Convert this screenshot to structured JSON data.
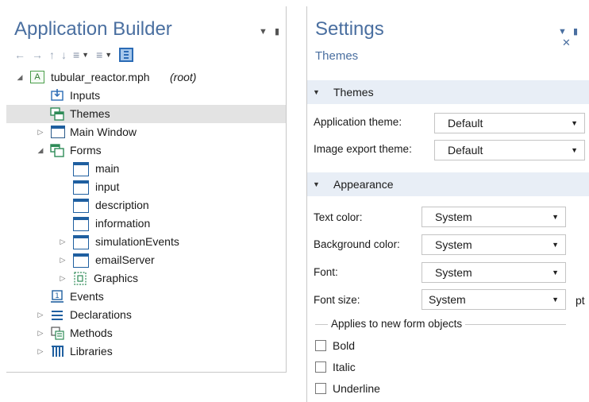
{
  "left": {
    "title": "Application Builder",
    "tree": {
      "root": {
        "label": "tubular_reactor.mph",
        "suffix": "(root)",
        "icon_letter": "A"
      },
      "items": [
        {
          "label": "Inputs"
        },
        {
          "label": "Themes"
        },
        {
          "label": "Main Window"
        },
        {
          "label": "Forms"
        },
        {
          "label": "main"
        },
        {
          "label": "input"
        },
        {
          "label": "description"
        },
        {
          "label": "information"
        },
        {
          "label": "simulationEvents"
        },
        {
          "label": "emailServer"
        },
        {
          "label": "Graphics"
        },
        {
          "label": "Events"
        },
        {
          "label": "Declarations"
        },
        {
          "label": "Methods"
        },
        {
          "label": "Libraries"
        }
      ]
    }
  },
  "right": {
    "title": "Settings",
    "subtitle": "Themes",
    "themes_section": {
      "header": "Themes",
      "application_theme": {
        "label": "Application theme:",
        "value": "Default"
      },
      "image_export_theme": {
        "label": "Image export theme:",
        "value": "Default"
      }
    },
    "appearance_section": {
      "header": "Appearance",
      "text_color": {
        "label": "Text color:",
        "value": "System"
      },
      "background_color": {
        "label": "Background color:",
        "value": "System"
      },
      "font": {
        "label": "Font:",
        "value": "System"
      },
      "font_size": {
        "label": "Font size:",
        "value": "System",
        "unit": "pt"
      },
      "group_label": "Applies to new form objects",
      "checkboxes": [
        {
          "label": "Bold",
          "checked": false
        },
        {
          "label": "Italic",
          "checked": false
        },
        {
          "label": "Underline",
          "checked": false
        }
      ]
    }
  },
  "colors": {
    "title_blue": "#4a6fa0",
    "section_header_bg": "#e8eef6",
    "selected_row_bg": "#e3e3e3",
    "icon_blue": "#1f5fa0"
  },
  "icons": {
    "toolbar": [
      "arrow-left-icon",
      "arrow-right-icon",
      "arrow-up-icon",
      "arrow-down-icon",
      "sort-up-icon",
      "sort-down-icon",
      "settings-panel-icon"
    ],
    "title_buttons": [
      "chevron-down-icon",
      "pin-icon",
      "close-icon"
    ]
  }
}
